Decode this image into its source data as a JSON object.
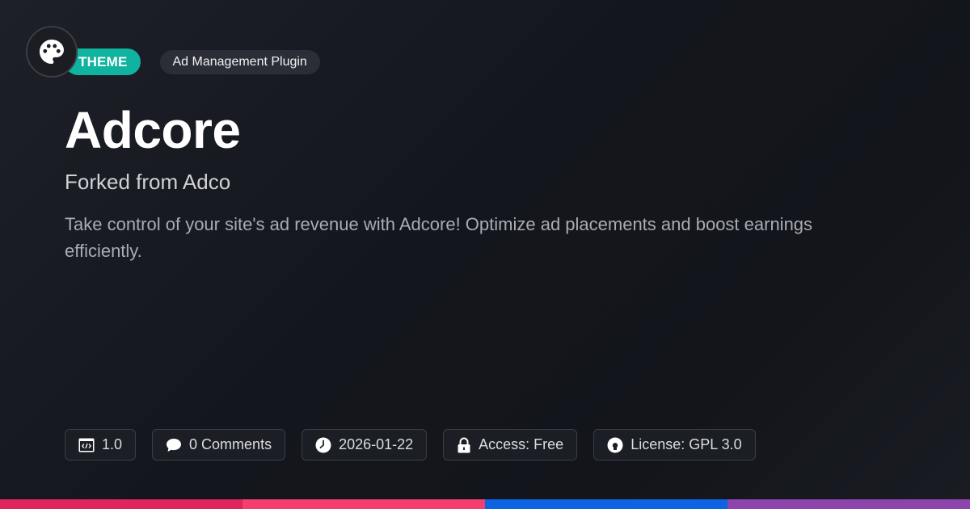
{
  "header": {
    "logo_icon": "palette-icon",
    "type_badge": "THEME",
    "category": "Ad Management Plugin"
  },
  "hero": {
    "title": "Adcore",
    "subtitle": "Forked from Adco",
    "description": "Take control of your site's ad revenue with Adcore! Optimize ad placements and boost earnings efficiently."
  },
  "meta": {
    "version": "1.0",
    "comments": "0 Comments",
    "date": "2026-01-22",
    "access": "Access: Free",
    "license": "License: GPL 3.0"
  },
  "colors": {
    "badge": "#10b3a0",
    "stripe": [
      "#e0245e",
      "#f43f6e",
      "#0c63e4",
      "#8e44ad"
    ]
  }
}
